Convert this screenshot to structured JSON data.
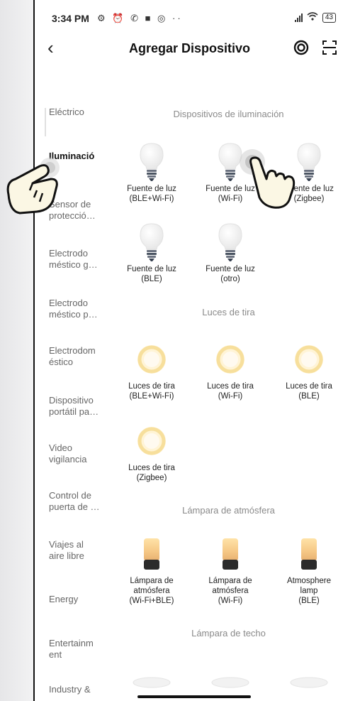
{
  "status_bar": {
    "time": "3:34 PM",
    "icons": "⚙ ⏰ ✆ ■ ◎ ··",
    "battery": "43"
  },
  "header": {
    "title": "Agregar Dispositivo",
    "back_icon": "back-arrow-icon",
    "action_icons": [
      "scan-target-icon",
      "scan-qr-icon"
    ]
  },
  "sidebar": {
    "categories": [
      "Eléctrico",
      "Iluminació",
      "Sensor de\nprotecció…",
      "Electrodo\nméstico g…",
      "Electrodo\nméstico p…",
      "Electrodom\néstico",
      "Dispositivo\nportátil pa…",
      "Video\nvigilancia",
      "Control de\npuerta de …",
      "Viajes al\naire libre",
      "Energy",
      "Entertainm\nent",
      "Industry &"
    ],
    "active": "Iluminació"
  },
  "sections": [
    {
      "title": "Dispositivos de iluminación",
      "items": [
        {
          "label": "Fuente de luz\n(BLE+Wi-Fi)",
          "icon": "bulb-icon"
        },
        {
          "label": "Fuente de luz\n(Wi-Fi)",
          "icon": "bulb-icon"
        },
        {
          "label": "Fuente de luz\n(Zigbee)",
          "icon": "bulb-icon"
        },
        {
          "label": "Fuente de luz\n(BLE)",
          "icon": "bulb-icon"
        },
        {
          "label": "Fuente de luz\n(otro)",
          "icon": "bulb-icon"
        }
      ]
    },
    {
      "title": "Luces de tira",
      "items": [
        {
          "label": "Luces de tira\n(BLE+Wi-Fi)",
          "icon": "strip-light-icon"
        },
        {
          "label": "Luces de tira\n(Wi-Fi)",
          "icon": "strip-light-icon"
        },
        {
          "label": "Luces de tira\n(BLE)",
          "icon": "strip-light-icon"
        },
        {
          "label": "Luces de tira\n(Zigbee)",
          "icon": "strip-light-icon"
        }
      ]
    },
    {
      "title": "Lámpara de atmósfera",
      "items": [
        {
          "label": "Lámpara de\natmósfera\n(Wi-Fi+BLE)",
          "icon": "atmosphere-lamp-icon"
        },
        {
          "label": "Lámpara de\natmósfera\n(Wi-Fi)",
          "icon": "atmosphere-lamp-icon"
        },
        {
          "label": "Atmosphere\nlamp\n(BLE)",
          "icon": "atmosphere-lamp-icon"
        }
      ]
    },
    {
      "title": "Lámpara de techo",
      "items": [
        {
          "label": "",
          "icon": "ceiling-lamp-icon"
        },
        {
          "label": "",
          "icon": "ceiling-lamp-icon"
        },
        {
          "label": "",
          "icon": "ceiling-lamp-icon"
        }
      ]
    }
  ],
  "overlay_icons": [
    "pointing-hand-icon",
    "pointing-hand-icon"
  ]
}
